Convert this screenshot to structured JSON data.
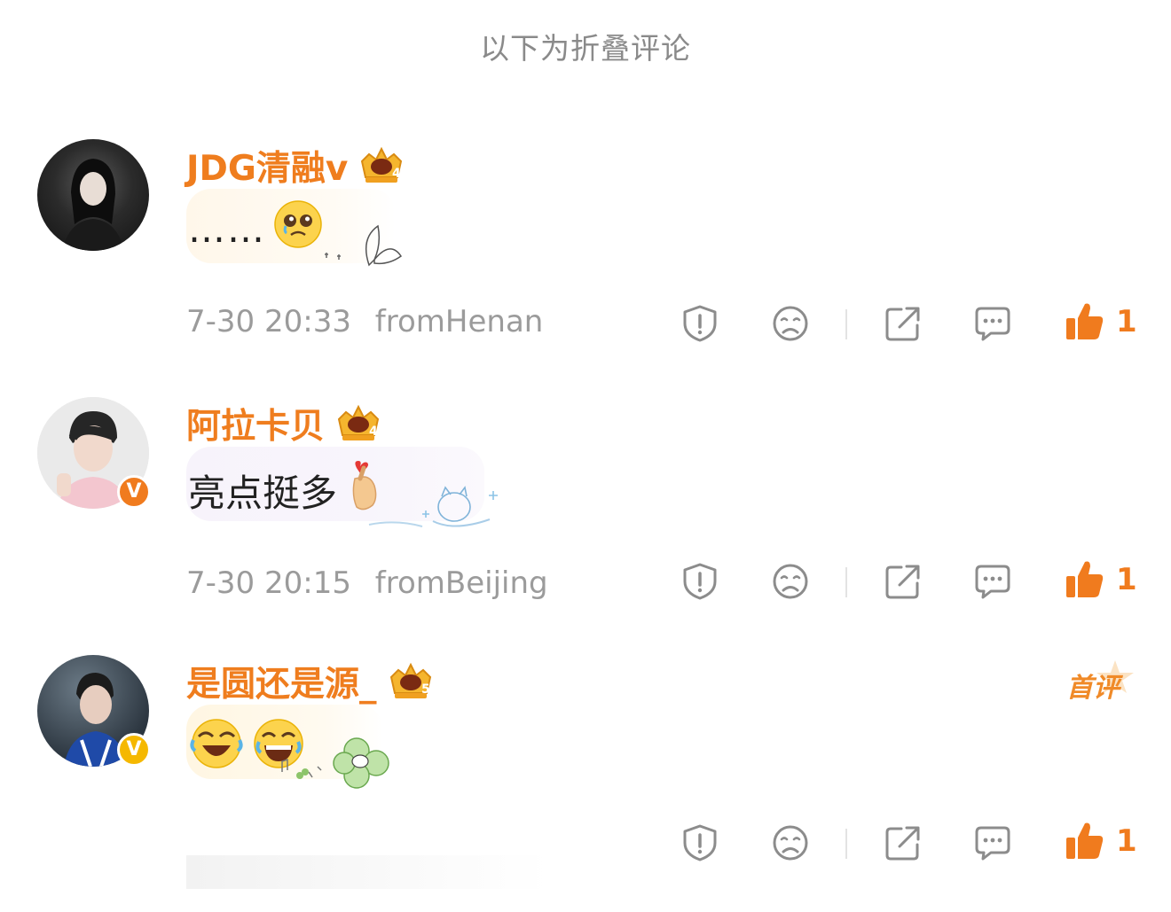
{
  "header": {
    "folded_label": "以下为折叠评论"
  },
  "comments": [
    {
      "username": "JDG清融v",
      "crown_level": "4",
      "text": "……",
      "emoji": "pleading-face",
      "timestamp": "7-30 20:33",
      "location": "fromHenan",
      "like_count": "1",
      "verified": false
    },
    {
      "username": "阿拉卡贝",
      "crown_level": "4",
      "text": "亮点挺多",
      "emoji": "finger-heart",
      "timestamp": "7-30 20:15",
      "location": "fromBeijing",
      "like_count": "1",
      "verified": true,
      "verify_color": "#f07b1e"
    },
    {
      "username": "是圆还是源_",
      "crown_level": "5",
      "text": "",
      "emoji": "rolling-laughing, joy",
      "timestamp": "",
      "location": "",
      "like_count": "1",
      "verified": true,
      "verify_color": "#f5b800",
      "badge": "首评"
    }
  ],
  "verify_letter": "V",
  "colors": {
    "accent": "#ef7d1e",
    "meta_text": "#9b9b9b",
    "icon_gray": "#8c8c8c"
  }
}
